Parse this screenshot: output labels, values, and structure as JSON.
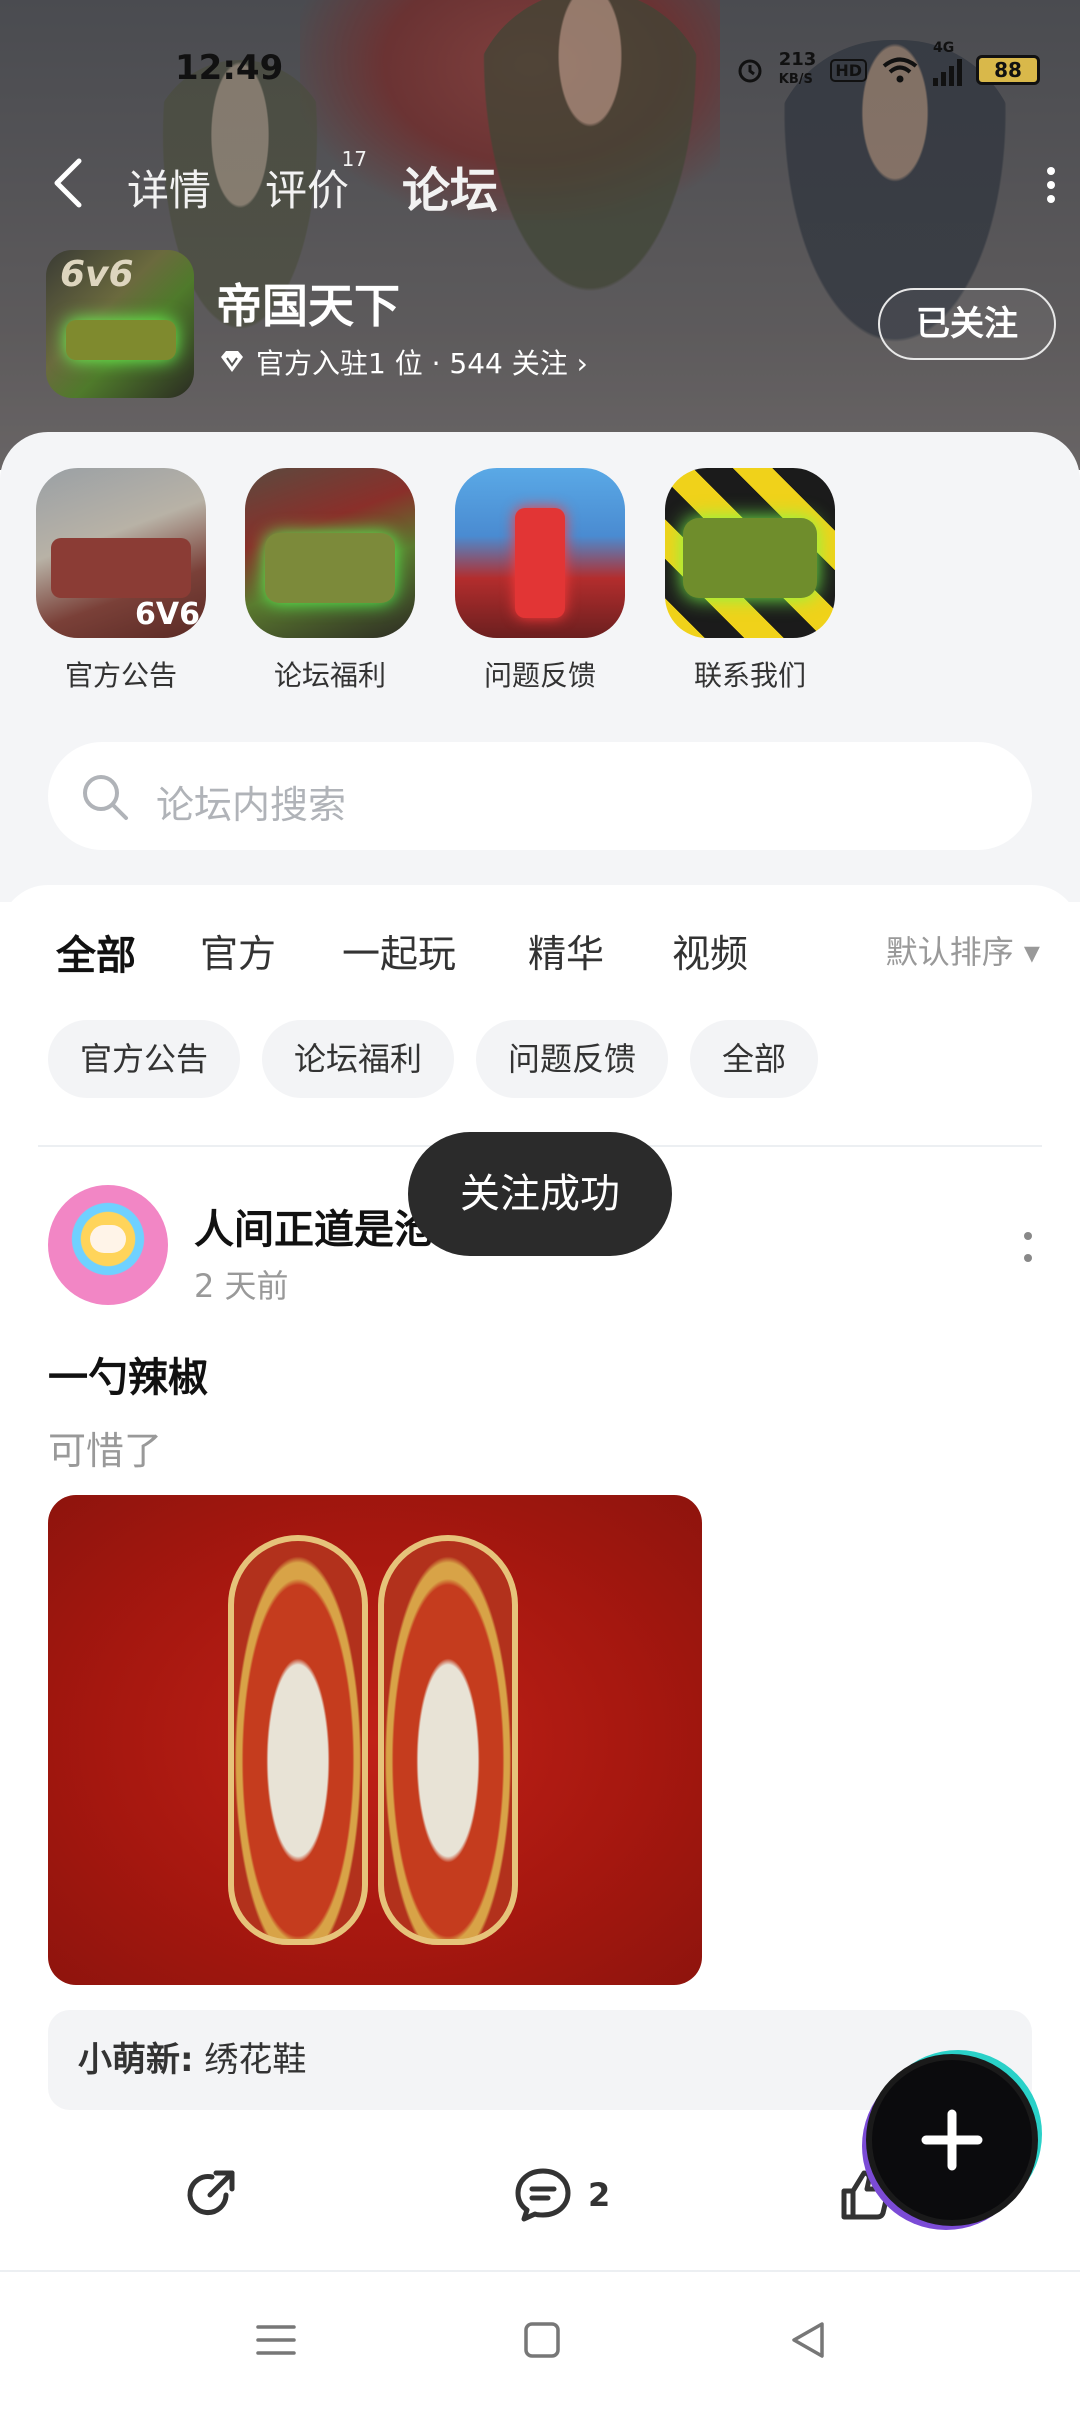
{
  "status_bar": {
    "time": "12:49",
    "net_speed_value": "213",
    "net_speed_unit": "KB/S",
    "hd": "HD",
    "network": "4G",
    "battery": "88"
  },
  "nav": {
    "tabs": [
      {
        "label": "详情"
      },
      {
        "label": "评价",
        "count": "17"
      },
      {
        "label": "论坛"
      }
    ],
    "active_tab": "论坛"
  },
  "game": {
    "icon_text": "6v6",
    "title": "帝国天下",
    "meta": "官方入驻1 位 · 544 关注 ›",
    "follow_label": "已关注"
  },
  "quick_links": [
    {
      "label": "官方公告",
      "badge": "6V6"
    },
    {
      "label": "论坛福利"
    },
    {
      "label": "问题反馈"
    },
    {
      "label": "联系我们"
    }
  ],
  "search": {
    "placeholder": "论坛内搜索"
  },
  "feed_tabs": [
    "全部",
    "官方",
    "一起玩",
    "精华",
    "视频"
  ],
  "sort_label": "默认排序 ▾",
  "chips": [
    "官方公告",
    "论坛福利",
    "问题反馈",
    "全部"
  ],
  "post": {
    "username": "人间正道是沧",
    "time": "2 天前",
    "title": "一勺辣椒",
    "body": "可惜了",
    "reply_user": "小萌新:",
    "reply_text": "绣花鞋",
    "comment_count": "2"
  },
  "toast": "关注成功",
  "colors": {
    "accent": "#2ed5c6",
    "toast_bg": "#2b2b2b"
  }
}
